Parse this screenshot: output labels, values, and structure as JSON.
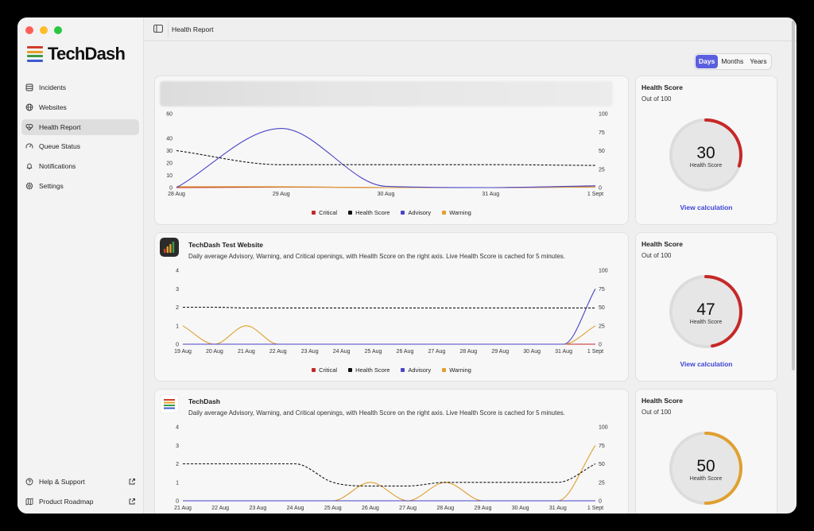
{
  "app": {
    "name": "TechDash",
    "page_title": "Health Report",
    "colors": {
      "accent": "#5a5fe0",
      "critical": "#c62828",
      "health_score": "#111111",
      "advisory": "#4a45c8",
      "warning": "#e0a030",
      "link": "#3d46d6"
    }
  },
  "sidebar": {
    "items": [
      {
        "label": "Incidents",
        "icon": "database-icon"
      },
      {
        "label": "Websites",
        "icon": "globe-icon"
      },
      {
        "label": "Health Report",
        "icon": "heart-pulse-icon",
        "active": true
      },
      {
        "label": "Queue Status",
        "icon": "gauge-icon"
      },
      {
        "label": "Notifications",
        "icon": "bell-icon"
      },
      {
        "label": "Settings",
        "icon": "gear-icon"
      }
    ],
    "footer": [
      {
        "label": "Help & Support",
        "icon": "help-circle-icon"
      },
      {
        "label": "Product Roadmap",
        "icon": "map-icon"
      }
    ]
  },
  "range_selector": {
    "options": [
      "Days",
      "Months",
      "Years"
    ],
    "selected": "Days"
  },
  "legend": [
    "Critical",
    "Health Score",
    "Advisory",
    "Warning"
  ],
  "score_panel": {
    "title": "Health Score",
    "subtitle": "Out of 100",
    "gauge_label": "Health Score",
    "link_label": "View calculation"
  },
  "sites": [
    {
      "name": "",
      "description": "",
      "health_score": 30,
      "gauge_color": "#c62828",
      "show_link": true,
      "chart_data": {
        "type": "line",
        "x_labels": [
          "28 Aug",
          "29 Aug",
          "30 Aug",
          "31 Aug",
          "1 Sept"
        ],
        "y_left": {
          "range": [
            0,
            60
          ],
          "ticks": [
            0,
            10,
            20,
            30,
            40,
            60
          ]
        },
        "y_right": {
          "range": [
            0,
            100
          ],
          "ticks": [
            0,
            25,
            50,
            75,
            100
          ]
        },
        "series": [
          {
            "name": "Critical",
            "axis": "left",
            "values": [
              0,
              0.5,
              0,
              0,
              0.6
            ]
          },
          {
            "name": "Health Score",
            "axis": "right",
            "values": [
              50,
              31,
              31,
              31,
              30
            ]
          },
          {
            "name": "Advisory",
            "axis": "left",
            "values": [
              0,
              48,
              1,
              0,
              1.5
            ]
          },
          {
            "name": "Warning",
            "axis": "left",
            "values": [
              0.8,
              0.8,
              0,
              0,
              0.5
            ]
          }
        ]
      }
    },
    {
      "name": "TechDash Test Website",
      "description": "Daily average Advisory, Warning, and Critical openings, with Health Score on the right axis. Live Health Score is cached for 5 minutes.",
      "health_score": 47,
      "gauge_color": "#c62828",
      "show_link": true,
      "chart_data": {
        "type": "line",
        "x_labels": [
          "19 Aug",
          "20 Aug",
          "21 Aug",
          "22 Aug",
          "23 Aug",
          "24 Aug",
          "25 Aug",
          "26 Aug",
          "27 Aug",
          "28 Aug",
          "29 Aug",
          "30 Aug",
          "31 Aug",
          "1 Sept"
        ],
        "y_left": {
          "range": [
            0,
            4
          ],
          "ticks": [
            0,
            1,
            2,
            3,
            4
          ]
        },
        "y_right": {
          "range": [
            0,
            100
          ],
          "ticks": [
            0,
            25,
            50,
            75,
            100
          ]
        },
        "series": [
          {
            "name": "Critical",
            "axis": "left",
            "values": [
              0,
              0,
              0,
              0,
              0,
              0,
              0,
              0,
              0,
              0,
              0,
              0,
              0,
              0
            ]
          },
          {
            "name": "Health Score",
            "axis": "right",
            "values": [
              50,
              50,
              49,
              49,
              49,
              49,
              49,
              49,
              49,
              49,
              49,
              49,
              49,
              49
            ]
          },
          {
            "name": "Advisory",
            "axis": "left",
            "values": [
              0,
              0,
              0,
              0,
              0,
              0,
              0,
              0,
              0,
              0,
              0,
              0,
              0,
              3
            ]
          },
          {
            "name": "Warning",
            "axis": "left",
            "values": [
              1,
              0,
              1,
              0,
              0,
              0,
              0,
              0,
              0,
              0,
              0,
              0,
              0,
              1
            ]
          }
        ]
      }
    },
    {
      "name": "TechDash",
      "description": "Daily average Advisory, Warning, and Critical openings, with Health Score on the right axis. Live Health Score is cached for 5 minutes.",
      "health_score": 50,
      "gauge_color": "#e0a030",
      "show_link": false,
      "chart_data": {
        "type": "line",
        "x_labels": [
          "21 Aug",
          "22 Aug",
          "23 Aug",
          "24 Aug",
          "25 Aug",
          "26 Aug",
          "27 Aug",
          "28 Aug",
          "29 Aug",
          "30 Aug",
          "31 Aug",
          "1 Sept"
        ],
        "y_left": {
          "range": [
            0,
            4
          ],
          "ticks": [
            0,
            1,
            2,
            3,
            4
          ]
        },
        "y_right": {
          "range": [
            0,
            100
          ],
          "ticks": [
            0,
            25,
            50,
            75,
            100
          ]
        },
        "series": [
          {
            "name": "Critical",
            "axis": "left",
            "values": [
              0,
              0,
              0,
              0,
              0,
              0,
              0,
              0,
              0,
              0,
              0,
              0
            ]
          },
          {
            "name": "Health Score",
            "axis": "right",
            "values": [
              50,
              50,
              50,
              50,
              25,
              20,
              20,
              25,
              25,
              25,
              25,
              50
            ]
          },
          {
            "name": "Advisory",
            "axis": "left",
            "values": [
              0,
              0,
              0,
              0,
              0,
              0,
              0,
              0,
              0,
              0,
              0,
              0
            ]
          },
          {
            "name": "Warning",
            "axis": "left",
            "values": [
              0,
              0,
              0,
              0,
              0,
              1,
              0,
              1,
              0,
              0,
              0,
              3
            ]
          }
        ]
      }
    }
  ]
}
